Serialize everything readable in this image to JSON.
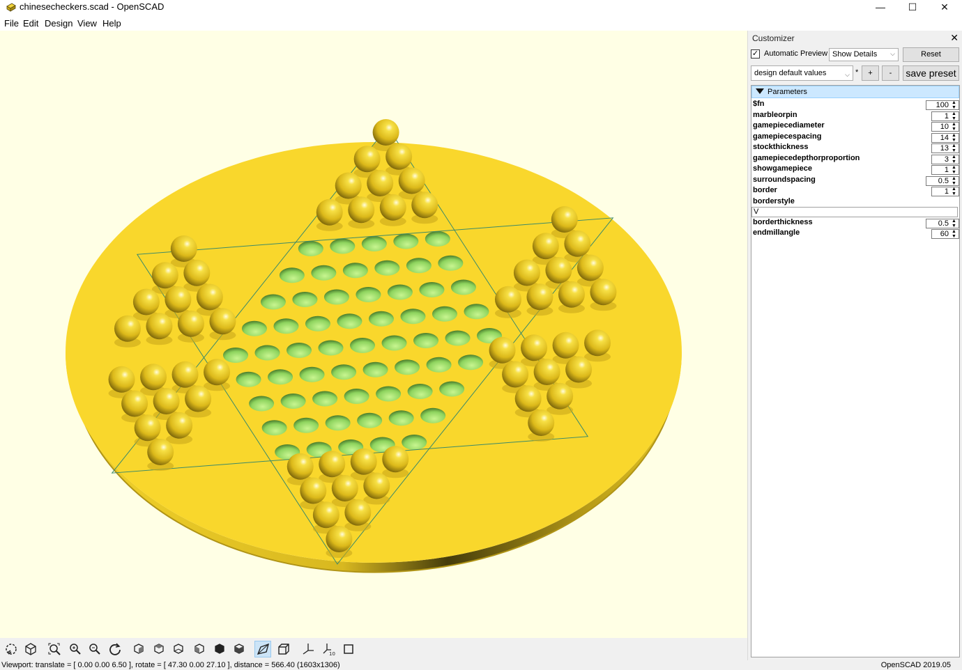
{
  "window": {
    "title": "chinesecheckers.scad - OpenSCAD",
    "controls": {
      "minimize": "—",
      "maximize": "☐",
      "close": "✕"
    }
  },
  "menu": [
    "File",
    "Edit",
    "Design",
    "View",
    "Help"
  ],
  "colors": {
    "viewport_bg": "#ffffe5",
    "model_top": "#f9d72c",
    "model_side": "#e0c020",
    "hole": "#a8e07a",
    "outline": "#3a8a6a",
    "selection": "#cce8ff"
  },
  "toolbar_icons": [
    "preview-icon",
    "render-icon",
    "view-all-icon",
    "zoom-in-icon",
    "zoom-out-icon",
    "reset-view-icon",
    "view-right-icon",
    "view-top-icon",
    "view-bottom-icon",
    "view-left-icon",
    "view-front-icon",
    "view-back-icon",
    "perspective-icon",
    "orthogonal-icon",
    "show-axes-icon",
    "show-scale-icon",
    "show-edges-icon"
  ],
  "status": {
    "viewport": "Viewport: translate = [ 0.00 0.00 6.50 ], rotate = [ 47.30 0.00 27.10 ], distance = 566.40 (1603x1306)",
    "version": "OpenSCAD 2019.05"
  },
  "customizer": {
    "title": "Customizer",
    "close": "✕",
    "automatic_preview_label": "Automatic Preview",
    "automatic_preview_checked": true,
    "details_select": "Show Details",
    "reset_label": "Reset",
    "preset_select": "design default values",
    "preset_modified_marker": "*",
    "add_preset": "+",
    "remove_preset": "-",
    "save_preset": "save preset",
    "section_label": "Parameters",
    "parameters": [
      {
        "name": "$fn",
        "value": "100"
      },
      {
        "name": "marbleorpin",
        "value": "1"
      },
      {
        "name": "gamepiecediameter",
        "value": "10"
      },
      {
        "name": "gamepiecespacing",
        "value": "14"
      },
      {
        "name": "stockthickness",
        "value": "13"
      },
      {
        "name": "gamepiecedepthorproportion",
        "value": "3"
      },
      {
        "name": "showgamepiece",
        "value": "1"
      },
      {
        "name": "surroundspacing",
        "value": "0.5"
      },
      {
        "name": "border",
        "value": "1"
      }
    ],
    "borderstyle": {
      "name": "borderstyle",
      "value": "V"
    },
    "parameters_after": [
      {
        "name": "borderthickness",
        "value": "0.5"
      },
      {
        "name": "endmillangle",
        "value": "60"
      }
    ]
  }
}
